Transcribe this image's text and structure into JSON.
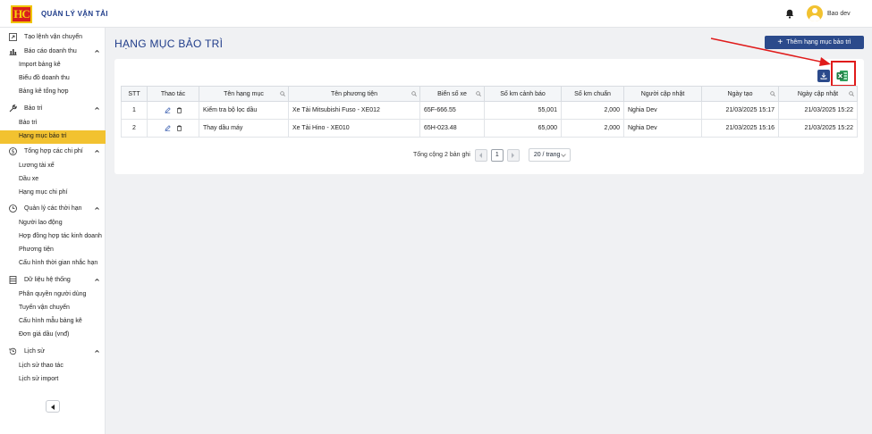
{
  "app": {
    "title": "QUẢN LÝ VẬN TẢI",
    "logo_text": "HC"
  },
  "header": {
    "user_name": "Bao dev"
  },
  "sidebar": {
    "items": [
      {
        "type": "group",
        "label": "Tạo lệnh vận chuyển",
        "icon": "external-link-icon",
        "expandable": false
      },
      {
        "type": "group",
        "label": "Báo cáo doanh thu",
        "icon": "chart-icon",
        "expandable": true
      },
      {
        "type": "item",
        "label": "Import bảng kê"
      },
      {
        "type": "item",
        "label": "Biểu đồ doanh thu"
      },
      {
        "type": "item",
        "label": "Bảng kê tổng hợp"
      },
      {
        "type": "group",
        "label": "Bảo trì",
        "icon": "wrench-icon",
        "expandable": true
      },
      {
        "type": "item",
        "label": "Bảo trì"
      },
      {
        "type": "item",
        "label": "Hạng mục bảo trì",
        "active": true
      },
      {
        "type": "group",
        "label": "Tổng hợp các chi phí",
        "icon": "dollar-icon",
        "expandable": true
      },
      {
        "type": "item",
        "label": "Lương tài xế"
      },
      {
        "type": "item",
        "label": "Dầu xe"
      },
      {
        "type": "item",
        "label": "Hạng mục chi phí"
      },
      {
        "type": "group",
        "label": "Quản lý các thời hạn",
        "icon": "clock-icon",
        "expandable": true
      },
      {
        "type": "item",
        "label": "Người lao động"
      },
      {
        "type": "item",
        "label": "Hợp đồng hợp tác kinh doanh"
      },
      {
        "type": "item",
        "label": "Phương tiện"
      },
      {
        "type": "item",
        "label": "Cấu hình thời gian nhắc hạn"
      },
      {
        "type": "group",
        "label": "Dữ liệu hệ thống",
        "icon": "database-icon",
        "expandable": true
      },
      {
        "type": "item",
        "label": "Phân quyền người dùng"
      },
      {
        "type": "item",
        "label": "Tuyến vận chuyển"
      },
      {
        "type": "item",
        "label": "Cấu hình mẫu bảng kê"
      },
      {
        "type": "item",
        "label": "Đơn giá dầu (vnđ)"
      },
      {
        "type": "group",
        "label": "Lịch sử",
        "icon": "history-icon",
        "expandable": true
      },
      {
        "type": "item",
        "label": "Lịch sử thao tác"
      },
      {
        "type": "item",
        "label": "Lịch sử import"
      }
    ]
  },
  "main": {
    "page_title": "HẠNG MỤC BẢO TRÌ",
    "add_button_label": "Thêm hạng mục bảo trì",
    "table": {
      "columns": [
        {
          "label": "STT",
          "searchable": false
        },
        {
          "label": "Thao tác",
          "searchable": false
        },
        {
          "label": "Tên hạng mục",
          "searchable": true
        },
        {
          "label": "Tên phương tiện",
          "searchable": true
        },
        {
          "label": "Biển số xe",
          "searchable": true
        },
        {
          "label": "Số km cảnh báo",
          "searchable": false
        },
        {
          "label": "Số km chuẩn",
          "searchable": false
        },
        {
          "label": "Người cập nhật",
          "searchable": false
        },
        {
          "label": "Ngày tạo",
          "searchable": true
        },
        {
          "label": "Ngày cập nhật",
          "searchable": true
        }
      ],
      "rows": [
        {
          "stt": "1",
          "name": "Kiểm tra bộ lọc dầu",
          "vehicle": "Xe Tải Mitsubishi Fuso - XE012",
          "plate": "65F-666.55",
          "warn_km": "55,001",
          "std_km": "2,000",
          "updated_by": "Nghia Dev",
          "created": "21/03/2025 15:17",
          "updated": "21/03/2025 15:22"
        },
        {
          "stt": "2",
          "name": "Thay dầu máy",
          "vehicle": "Xe Tải Hino - XE010",
          "plate": "65H-023.48",
          "warn_km": "65,000",
          "std_km": "2,000",
          "updated_by": "Nghia Dev",
          "created": "21/03/2025 15:16",
          "updated": "21/03/2025 15:22"
        }
      ]
    },
    "pagination": {
      "total_text": "Tổng cộng 2 bản ghi",
      "current_page": "1",
      "page_size": "20 / trang"
    }
  },
  "colors": {
    "primary": "#2b4a8b",
    "active_menu": "#f2c230",
    "highlight": "#e01b1b",
    "excel": "#1e7a43"
  }
}
